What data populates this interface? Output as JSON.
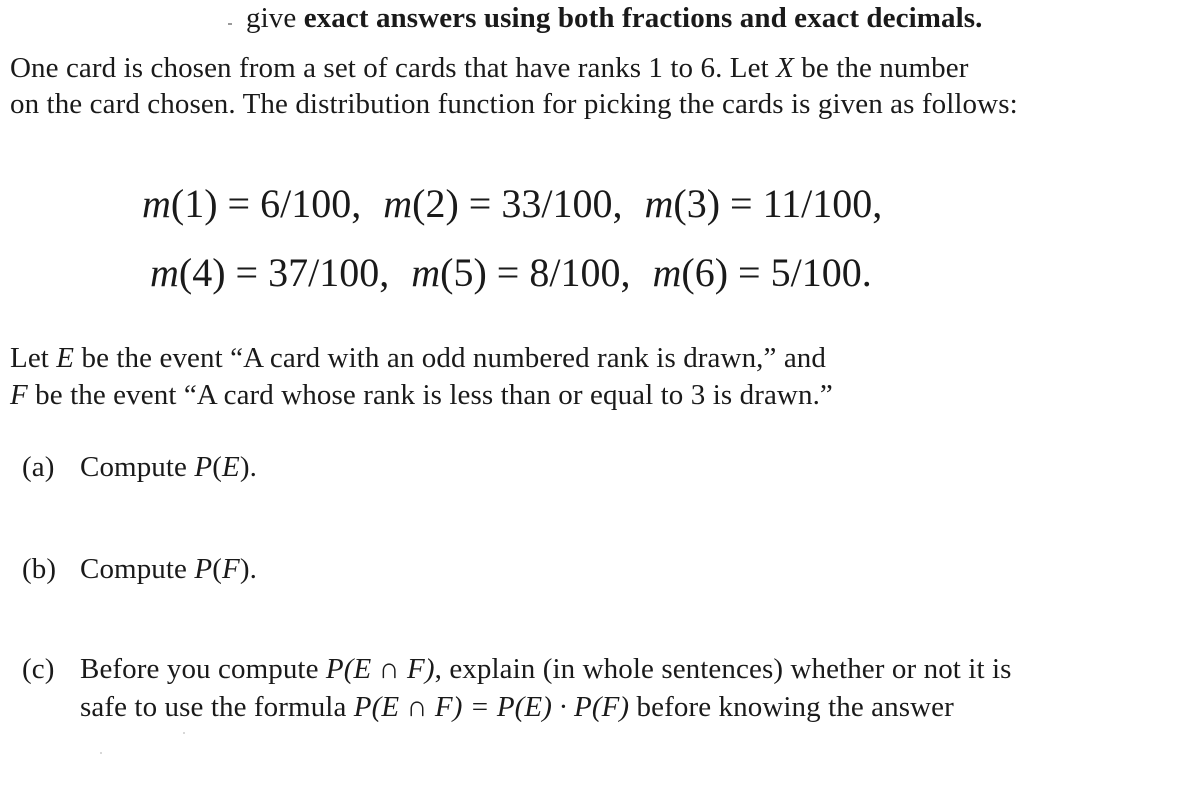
{
  "header": {
    "prefix": "give ",
    "bold_text": "exact answers using both fractions and exact decimals."
  },
  "intro": {
    "line1_pre": "One card is chosen from a set of cards that have ranks 1 to 6.  Let ",
    "line1_var": "X",
    "line1_post": " be the number",
    "line2": "on the card chosen. The distribution function for picking the cards is given as follows:"
  },
  "distribution": [
    {
      "fn": "m",
      "rank": "1",
      "value": "6/100"
    },
    {
      "fn": "m",
      "rank": "2",
      "value": "33/100"
    },
    {
      "fn": "m",
      "rank": "3",
      "value": "11/100"
    },
    {
      "fn": "m",
      "rank": "4",
      "value": "37/100"
    },
    {
      "fn": "m",
      "rank": "5",
      "value": "8/100"
    },
    {
      "fn": "m",
      "rank": "6",
      "value": "5/100"
    }
  ],
  "events": {
    "e_pre": "Let ",
    "e_var": "E",
    "e_post": " be the event “A card with an odd numbered rank is drawn,” and",
    "f_var": "F",
    "f_post": " be the event “A card whose rank is less than or equal to 3 is drawn.”"
  },
  "questions": {
    "a": {
      "label": "(a)",
      "text": "Compute ",
      "expr_p": "P",
      "expr_var": "E",
      "end": ")."
    },
    "b": {
      "label": "(b)",
      "text": "Compute ",
      "expr_p": "P",
      "expr_var": "F",
      "end": ")."
    },
    "c": {
      "label": "(c)",
      "line1_pre": "Before you compute ",
      "line1_expr": "P(E ∩ F)",
      "line1_post": ", explain (in whole sentences) whether or not it is",
      "line2_pre": "safe to use the formula ",
      "line2_expr": "P(E ∩ F) = P(E) · P(F)",
      "line2_post": " before knowing the answer"
    }
  }
}
